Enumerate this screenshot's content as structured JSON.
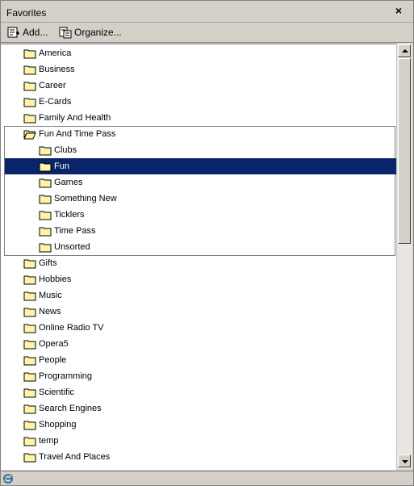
{
  "header": {
    "title": "Favorites",
    "close_glyph": "×"
  },
  "toolbar": {
    "add_label": "Add...",
    "organize_label": "Organize..."
  },
  "favorites": {
    "top": [
      "America",
      "Business",
      "Career",
      "E-Cards",
      "Family And Health"
    ],
    "open_folder": "Fun And Time Pass",
    "subfolders": [
      "Clubs",
      "Fun",
      "Games",
      "Something New",
      "Ticklers",
      "Time Pass",
      "Unsorted"
    ],
    "selected": "Fun",
    "rest": [
      "Gifts",
      "Hobbies",
      "Music",
      "News",
      "Online Radio TV",
      "Opera5",
      "People",
      "Programming",
      "Scientific",
      "Search Engines",
      "Shopping",
      "temp",
      "Travel And Places"
    ]
  },
  "colors": {
    "selection": "#0a246a",
    "folder": "#fff4a8",
    "window": "#d4d0c8"
  },
  "icons": {
    "folder": "folder-icon",
    "open_folder": "open-folder-icon",
    "status": "ie-icon"
  }
}
